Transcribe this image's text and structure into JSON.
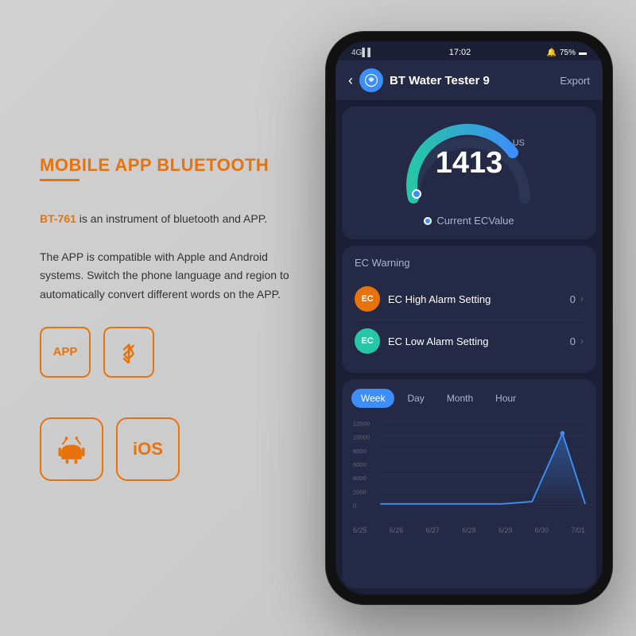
{
  "left": {
    "main_title": "MOBILE APP BLUETOOTH",
    "description_part1": " is an instrument of bluetooth and APP.",
    "description_part2": "The APP is compatible with Apple and Android systems. Switch the phone language and region to automatically convert different words on the APP.",
    "bt761": "BT-761",
    "app_label": "APP",
    "bluetooth_label": "🔊",
    "android_label": "Android",
    "ios_label": "iOS"
  },
  "phone": {
    "status_bar": {
      "time": "17:02",
      "signal": "4G",
      "battery": "75%"
    },
    "header": {
      "title": "BT Water Tester 9",
      "export": "Export"
    },
    "gauge": {
      "value": "1413",
      "unit": "US",
      "label": "Current  ECValue"
    },
    "ec_warning": {
      "title": "EC Warning",
      "items": [
        {
          "badge": "EC",
          "label": "EC High Alarm Setting",
          "value": "0",
          "color": "orange"
        },
        {
          "badge": "EC",
          "label": "EC Low Alarm Setting",
          "value": "0",
          "color": "teal"
        }
      ]
    },
    "chart": {
      "tabs": [
        "Week",
        "Day",
        "Month",
        "Hour"
      ],
      "active_tab": "Week",
      "y_labels": [
        "12000",
        "10000",
        "8000",
        "6000",
        "4000",
        "2000",
        "0"
      ],
      "x_labels": [
        "6/25",
        "6/26",
        "6/27",
        "6/28",
        "6/29",
        "6/30",
        "7/01"
      ]
    }
  }
}
